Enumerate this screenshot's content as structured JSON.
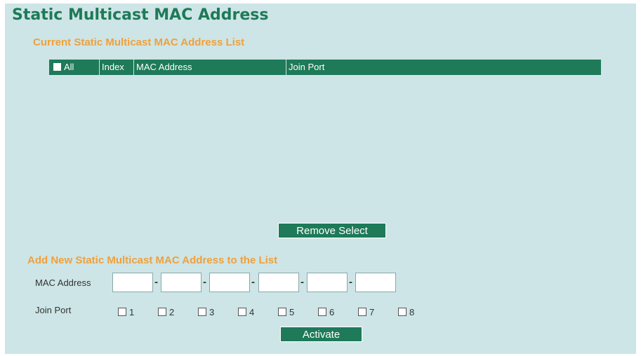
{
  "page": {
    "title": "Static Multicast MAC Address"
  },
  "list_section": {
    "title": "Current Static Multicast MAC Address List",
    "columns": {
      "all": "All",
      "index": "Index",
      "mac": "MAC Address",
      "join_port": "Join Port"
    },
    "rows": [],
    "remove_button": "Remove Select"
  },
  "add_section": {
    "title": "Add New Static Multicast MAC Address to the List",
    "mac_label": "MAC Address",
    "mac_octets": [
      "",
      "",
      "",
      "",
      "",
      ""
    ],
    "separator": "-",
    "join_port_label": "Join Port",
    "ports": [
      "1",
      "2",
      "3",
      "4",
      "5",
      "6",
      "7",
      "8"
    ],
    "activate_button": "Activate"
  },
  "colors": {
    "accent": "#1e7a58",
    "section_title": "#f0a03c",
    "background": "#cde5e6"
  }
}
